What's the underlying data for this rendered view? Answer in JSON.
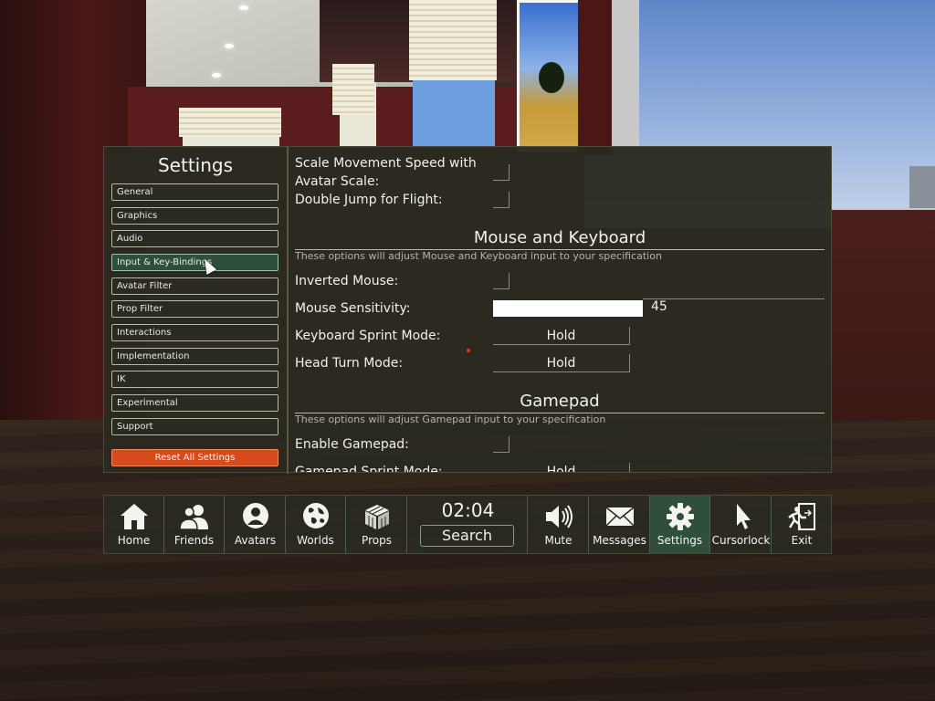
{
  "settings": {
    "title": "Settings",
    "menu": [
      {
        "label": "General"
      },
      {
        "label": "Graphics"
      },
      {
        "label": "Audio"
      },
      {
        "label": "Input & Key-Bindings"
      },
      {
        "label": "Avatar Filter"
      },
      {
        "label": "Prop Filter"
      },
      {
        "label": "Interactions"
      },
      {
        "label": "Implementation"
      },
      {
        "label": "IK"
      },
      {
        "label": "Experimental"
      },
      {
        "label": "Support"
      }
    ],
    "active_menu": "Input & Key-Bindings",
    "reset_label": "Reset All Settings"
  },
  "content": {
    "scale_speed_line1": "Scale Movement Speed with",
    "scale_speed_line2": "Avatar Scale:",
    "double_jump": "Double Jump for Flight:",
    "mouse_keyboard": {
      "title": "Mouse and Keyboard",
      "description": "These options will adjust Mouse and Keyboard input to your specification",
      "inverted_mouse": "Inverted Mouse:",
      "mouse_sensitivity": "Mouse Sensitivity:",
      "mouse_sensitivity_value": "45",
      "keyboard_sprint": "Keyboard Sprint Mode:",
      "keyboard_sprint_value": "Hold",
      "head_turn": "Head Turn Mode:",
      "head_turn_value": "Hold"
    },
    "gamepad": {
      "title": "Gamepad",
      "description": "These options will adjust Gamepad input to your specification",
      "enable": "Enable Gamepad:",
      "sprint": "Gamepad Sprint Mode:",
      "sprint_value": "Hold"
    }
  },
  "toolbar": {
    "home": "Home",
    "friends": "Friends",
    "avatars": "Avatars",
    "worlds": "Worlds",
    "props": "Props",
    "time": "02:04",
    "search": "Search",
    "mute": "Mute",
    "messages": "Messages",
    "settings": "Settings",
    "cursorlock": "Cursorlock",
    "exit": "Exit",
    "active": "Settings"
  },
  "colors": {
    "panel": "#2b2a20",
    "active": "#2f4f3c",
    "reset": "#d84a1c"
  }
}
